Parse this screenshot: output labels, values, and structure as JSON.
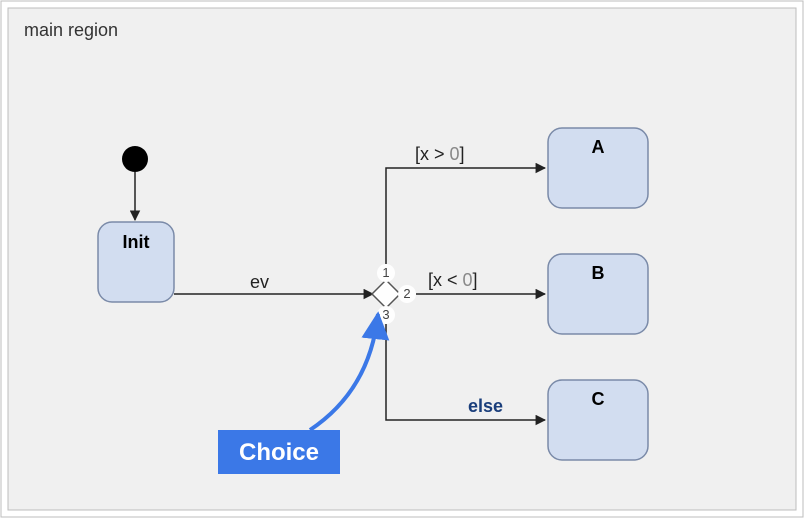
{
  "region": {
    "title": "main region"
  },
  "states": {
    "init": {
      "label": "Init"
    },
    "A": {
      "label": "A"
    },
    "B": {
      "label": "B"
    },
    "C": {
      "label": "C"
    }
  },
  "transitions": {
    "ev": {
      "label": "ev"
    },
    "g1": {
      "prefix": "[x > ",
      "num": "0",
      "suffix": "]"
    },
    "g2": {
      "prefix": "[x < ",
      "num": "0",
      "suffix": "]"
    },
    "else": {
      "label": "else"
    }
  },
  "choice": {
    "ports": {
      "p1": "1",
      "p2": "2",
      "p3": "3"
    }
  },
  "annotation": {
    "label": "Choice"
  }
}
